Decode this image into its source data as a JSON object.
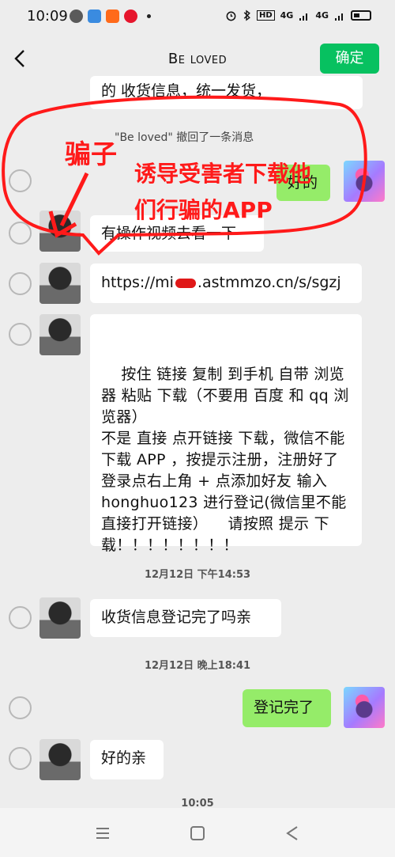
{
  "status_bar": {
    "time": "10:09",
    "signal_1": "4G",
    "signal_2": "4G",
    "hd": "HD"
  },
  "navbar": {
    "title": "Be loved",
    "confirm_label": "确定"
  },
  "messages": {
    "m0": "的  收货信息，统一发货，",
    "recall": "\"Be loved\" 撤回了一条消息",
    "m1": "好的",
    "m2": "有操作视频去看一下",
    "m3_prefix": "https://mi",
    "m3_suffix": ".astmmzo.cn/s/sgzj",
    "m4": "按住 链接 复制 到手机 自带 浏览器 粘贴 下载（不要用 百度 和 qq 浏览器）\n不是 直接 点开链接 下载，微信不能 下载 APP ，按提示注册，注册好了登录点右上角 + 点添加好友 输入 honghuo123 进行登记(微信里不能直接打开链接）    请按照 提示 下载！！！！！！！！",
    "ts1": "12月12日 下午14:53",
    "m5": "收货信息登记完了吗亲",
    "ts2": "12月12日 晚上18:41",
    "m6": "登记完了",
    "m7": "好的亲",
    "ts3": "10:05"
  },
  "annotation": {
    "label_1": "骗子",
    "label_2": "诱导受害者下载他",
    "label_3": "们行骗的APP",
    "color": "#ff1a1a"
  },
  "colors": {
    "confirm": "#07c160",
    "my_bubble": "#95ec69"
  }
}
